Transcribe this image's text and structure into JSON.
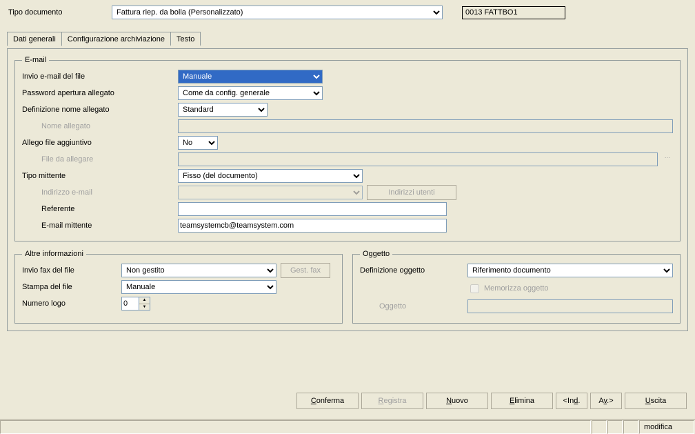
{
  "header": {
    "tipoDocumentoLabel": "Tipo documento",
    "tipoDocumentoValue": "Fattura riep. da bolla (Personalizzato)",
    "code": "0013 FATTBO1"
  },
  "tabs": {
    "datiGenerali": "Dati generali",
    "configurazione": "Configurazione archiviazione",
    "testo": "Testo"
  },
  "email": {
    "legend": "E-mail",
    "invioLabel": "Invio e-mail del file",
    "invioValue": "Manuale",
    "passwordLabel": "Password apertura allegato",
    "passwordValue": "Come da config. generale",
    "defNomeLabel": "Definizione nome allegato",
    "defNomeValue": "Standard",
    "nomeAllegatoLabel": "Nome allegato",
    "nomeAllegatoValue": "",
    "allegoAggLabel": "Allego file aggiuntivo",
    "allegoAggValue": "No",
    "fileDaAllegareLabel": "File da allegare",
    "fileDaAllegareValue": "",
    "tipoMittenteLabel": "Tipo mittente",
    "tipoMittenteValue": "Fisso (del documento)",
    "indirizzoEmailLabel": "Indirizzo e-mail",
    "indirizzoEmailValue": "",
    "indirizziUtentiBtn": "Indirizzi utenti",
    "referenteLabel": "Referente",
    "referenteValue": "",
    "emailMittenteLabel": "E-mail mittente",
    "emailMittenteValue": "teamsystemcb@teamsystem.com"
  },
  "altre": {
    "legend": "Altre informazioni",
    "invioFaxLabel": "Invio fax del file",
    "invioFaxValue": "Non gestito",
    "gestFaxBtn": "Gest. fax",
    "stampaLabel": "Stampa del file",
    "stampaValue": "Manuale",
    "numeroLogoLabel": "Numero logo",
    "numeroLogoValue": "0"
  },
  "oggetto": {
    "legend": "Oggetto",
    "defOggettoLabel": "Definizione oggetto",
    "defOggettoValue": "Riferimento documento",
    "memorizzaLabel": "Memorizza oggetto",
    "oggettoLabel": "Oggetto",
    "oggettoValue": ""
  },
  "buttons": {
    "conferma": "Conferma",
    "registra": "Registra",
    "nuovo": "Nuovo",
    "elimina": "Elimina",
    "ind": "<Ind.",
    "av": "Av.>",
    "uscita": "Uscita"
  },
  "status": {
    "modifica": "modifica"
  }
}
